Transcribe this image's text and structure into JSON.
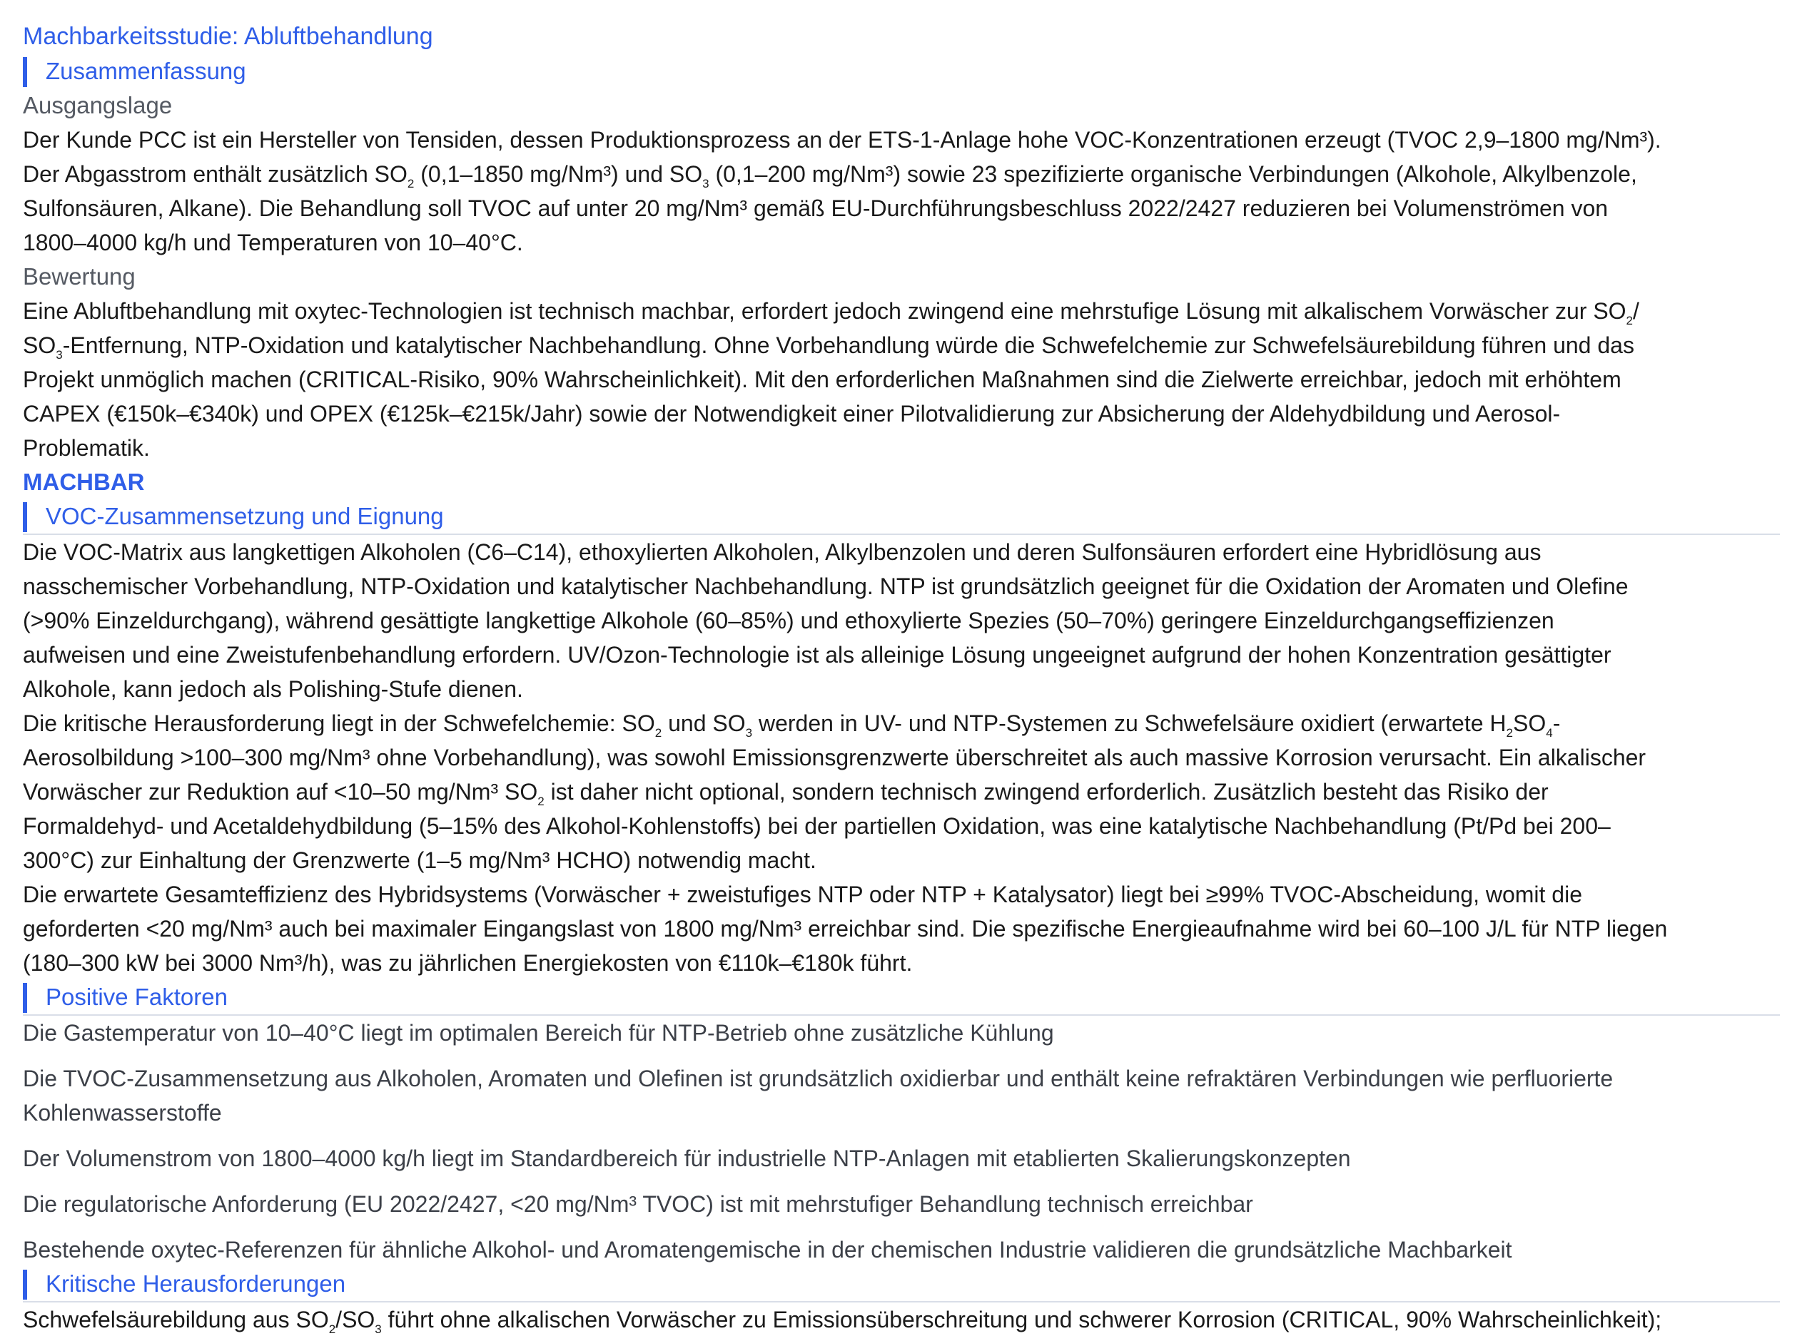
{
  "title": "Machbarkeitsstudie: Abluftbehandlung",
  "summary": {
    "heading": "Zusammenfassung",
    "situation_heading": "Ausgangslage",
    "situation": {
      "l1": "Der Kunde PCC ist ein Hersteller von Tensiden, dessen Produktionsprozess an der ETS-1-Anlage hohe VOC-Konzentrationen erzeugt (TVOC 2,9–1800 mg/Nm³).",
      "l2a": "Der Abgasstrom enthält zusätzlich SO",
      "l2b": " (0,1–1850 mg/Nm³) und SO",
      "l2c": " (0,1–200 mg/Nm³) sowie 23 spezifizierte organische Verbindungen (Alkohole, Alkylbenzole,",
      "l3": "Sulfonsäuren, Alkane). Die Behandlung soll TVOC auf unter 20 mg/Nm³ gemäß EU-Durchführungsbeschluss 2022/2427 reduzieren bei Volumenströmen von",
      "l4": "1800–4000 kg/h und Temperaturen von 10–40°C."
    },
    "assessment_heading": "Bewertung",
    "assessment": {
      "l1a": "Eine Abluftbehandlung mit oxytec-Technologien ist technisch machbar, erfordert jedoch zwingend eine mehrstufige Lösung mit alkalischem Vorwäscher zur SO",
      "l1b": "/",
      "l2a": "SO",
      "l2b": "-Entfernung, NTP-Oxidation und katalytischer Nachbehandlung. Ohne Vorbehandlung würde die Schwefelchemie zur Schwefelsäurebildung führen und das",
      "l3": "Projekt unmöglich machen (CRITICAL-Risiko, 90% Wahrscheinlichkeit). Mit den erforderlichen Maßnahmen sind die Zielwerte erreichbar, jedoch mit erhöhtem",
      "l4": "CAPEX (€150k–€340k) und OPEX (€125k–€215k/Jahr) sowie der Notwendigkeit einer Pilotvalidierung zur Absicherung der Aldehydbildung und Aerosol-",
      "l5": "Problematik."
    },
    "verdict": "MACHBAR"
  },
  "voc": {
    "heading": "VOC-Zusammensetzung und Eignung",
    "p1": {
      "l1": "Die VOC-Matrix aus langkettigen Alkoholen (C6–C14), ethoxylierten Alkoholen, Alkylbenzolen und deren Sulfonsäuren erfordert eine Hybridlösung aus",
      "l2": "nasschemischer Vorbehandlung, NTP-Oxidation und katalytischer Nachbehandlung. NTP ist grundsätzlich geeignet für die Oxidation der Aromaten und Olefine",
      "l3": "(>90% Einzeldurchgang), während gesättigte langkettige Alkohole (60–85%) und ethoxylierte Spezies (50–70%) geringere Einzeldurchgangseffizienzen",
      "l4": "aufweisen und eine Zweistufenbehandlung erfordern. UV/Ozon-Technologie ist als alleinige Lösung ungeeignet aufgrund der hohen Konzentration gesättigter",
      "l5": "Alkohole, kann jedoch als Polishing-Stufe dienen."
    },
    "p2": {
      "l1a": "Die kritische Herausforderung liegt in der Schwefelchemie: SO",
      "l1b": " und SO",
      "l1c": " werden in UV- und NTP-Systemen zu Schwefelsäure oxidiert (erwartete H",
      "l1d": "SO",
      "l1e": "-",
      "l2": "Aerosolbildung >100–300 mg/Nm³ ohne Vorbehandlung), was sowohl Emissionsgrenzwerte überschreitet als auch massive Korrosion verursacht. Ein alkalischer",
      "l3a": "Vorwäscher zur Reduktion auf <10–50 mg/Nm³ SO",
      "l3b": " ist daher nicht optional, sondern technisch zwingend erforderlich. Zusätzlich besteht das Risiko der",
      "l4": "Formaldehyd- und Acetaldehydbildung (5–15% des Alkohol-Kohlenstoffs) bei der partiellen Oxidation, was eine katalytische Nachbehandlung (Pt/Pd bei 200–",
      "l5": "300°C) zur Einhaltung der Grenzwerte (1–5 mg/Nm³ HCHO) notwendig macht."
    },
    "p3": {
      "l1": "Die erwartete Gesamteffizienz des Hybridsystems (Vorwäscher + zweistufiges NTP oder NTP + Katalysator) liegt bei ≥99% TVOC-Abscheidung, womit die",
      "l2": "geforderten <20 mg/Nm³ auch bei maximaler Eingangslast von 1800 mg/Nm³ erreichbar sind. Die spezifische Energieaufnahme wird bei 60–100 J/L für NTP liegen",
      "l3": "(180–300 kW bei 3000 Nm³/h), was zu jährlichen Energiekosten von €110k–€180k führt."
    }
  },
  "positive": {
    "heading": "Positive Faktoren",
    "f1": "Die Gastemperatur von 10–40°C liegt im optimalen Bereich für NTP-Betrieb ohne zusätzliche Kühlung",
    "f2a": "Die TVOC-Zusammensetzung aus Alkoholen, Aromaten und Olefinen ist grundsätzlich oxidierbar und enthält keine refraktären Verbindungen wie perfluorierte",
    "f2b": "Kohlenwasserstoffe",
    "f3": "Der Volumenstrom von 1800–4000 kg/h liegt im Standardbereich für industrielle NTP-Anlagen mit etablierten Skalierungskonzepten",
    "f4": "Die regulatorische Anforderung (EU 2022/2427, <20 mg/Nm³ TVOC) ist mit mehrstufiger Behandlung technisch erreichbar",
    "f5": "Bestehende oxytec-Referenzen für ähnliche Alkohol- und Aromatengemische in der chemischen Industrie validieren die grundsätzliche Machbarkeit"
  },
  "critical": {
    "heading": "Kritische Herausforderungen",
    "c1a": "Schwefelsäurebildung aus SO",
    "c1b": "/SO",
    "c1c": " führt ohne alkalischen Vorwäscher zu Emissionsüberschreitung und schwerer Korrosion (CRITICAL, 90% Wahrscheinlichkeit);"
  },
  "sub": {
    "two": "2",
    "three": "3",
    "four": "4"
  }
}
